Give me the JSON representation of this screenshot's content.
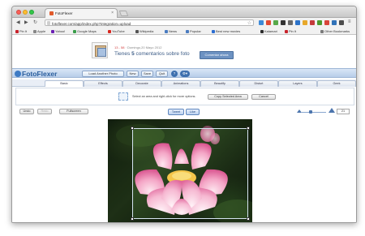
{
  "browser": {
    "tab_title": "FotoFlexer",
    "tab_close": "×",
    "url": "fotoflexer.com/app/index.php?integration=upload",
    "nav": {
      "back": "◀",
      "forward": "▶",
      "reload": "↻"
    }
  },
  "bookmarks": [
    {
      "label": "Pin It",
      "color": "#c8232c"
    },
    {
      "label": "Apple",
      "color": "#888888"
    },
    {
      "label": "Yahoo!",
      "color": "#6b1fb4"
    },
    {
      "label": "Google Maps",
      "color": "#3a9d4a"
    },
    {
      "label": "YouTube",
      "color": "#d8261e"
    },
    {
      "label": "Wikipedia",
      "color": "#555555"
    },
    {
      "label": "News",
      "color": "#4a7bc0"
    },
    {
      "label": "Popular",
      "color": "#4a7bc0"
    },
    {
      "label": "Best new movies",
      "color": "#2b6dd1"
    },
    {
      "label": "Kalamari",
      "color": "#2b2b2b"
    },
    {
      "label": "Pin It",
      "color": "#c8232c"
    },
    {
      "label": "Other Bookmarks",
      "color": "#7a7a7a"
    }
  ],
  "hero": {
    "date_num": "13 - 58",
    "date_text": " · Domingo,20 Mayo 2012",
    "comments_prefix": "Tienes ",
    "comments_num": "5",
    "comments_suffix": " comentarios sobre foto",
    "button": "Comentar ahora"
  },
  "ffbar": {
    "logo": "FotoFlexer",
    "load_another": "Load Another Photo",
    "new": "New",
    "save": "Save",
    "quit": "Quit",
    "help": "?"
  },
  "tabs": [
    "Basic",
    "Effects",
    "Decorate",
    "Animations",
    "Beautify",
    "Distort",
    "Layers",
    "Geek"
  ],
  "active_tab": "Basic",
  "instructions": {
    "text": "Select an area and right-click for more options.",
    "copy_button": "Copy Selected Area",
    "cancel_button": "Cancel"
  },
  "editbar": {
    "undo": "Undo",
    "redo": "Redo",
    "fullscreen": "Fullscreen",
    "tweet": "Tweet",
    "like": "Like",
    "zoom_value": "21"
  },
  "colors": {
    "accent": "#3b5b86",
    "hero_button": "#6d92c2",
    "lotus_pink": "#f28db5",
    "lotus_center": "#f5c64a"
  }
}
